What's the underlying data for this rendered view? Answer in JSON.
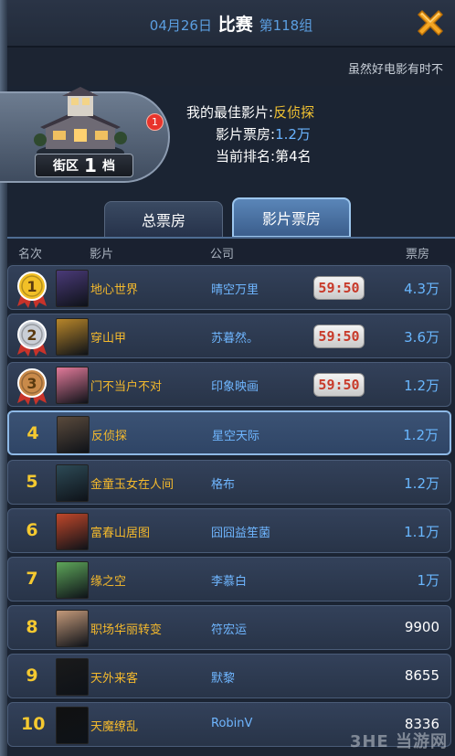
{
  "header": {
    "date": "04月26日",
    "title": "比赛",
    "group": "第118组"
  },
  "ticker": {
    "text": "虽然好电影有时不"
  },
  "district": {
    "label": "街区",
    "level": "1",
    "unit": "档",
    "badge_count": "1"
  },
  "summary": {
    "best_movie_label": "我的最佳影片:",
    "best_movie_value": "反侦探",
    "box_office_label": "影片票房:",
    "box_office_value": "1.2万",
    "rank_label": "当前排名:",
    "rank_value": "第4名"
  },
  "tabs": [
    {
      "label": "总票房",
      "active": false
    },
    {
      "label": "影片票房",
      "active": true
    }
  ],
  "columns": {
    "rank": "名次",
    "movie": "影片",
    "company": "公司",
    "box_office": "票房"
  },
  "rows": [
    {
      "rank": "1",
      "movie": "地心世界",
      "company": "晴空万里",
      "timer": "59:50",
      "box_office": "4.3万",
      "poster": "#4a3a78"
    },
    {
      "rank": "2",
      "movie": "穿山甲",
      "company": "苏暮然。",
      "timer": "59:50",
      "box_office": "3.6万",
      "poster": "#b8862a"
    },
    {
      "rank": "3",
      "movie": "门不当户不对",
      "company": "印象映画",
      "timer": "59:50",
      "box_office": "1.2万",
      "poster": "#e27a9a"
    },
    {
      "rank": "4",
      "movie": "反侦探",
      "company": "星空天际",
      "timer": "",
      "box_office": "1.2万",
      "poster": "#5a4a3c"
    },
    {
      "rank": "5",
      "movie": "金童玉女在人间",
      "company": "格布",
      "timer": "",
      "box_office": "1.2万",
      "poster": "#2d4a56"
    },
    {
      "rank": "6",
      "movie": "富春山居图",
      "company": "囧囧益笙菌",
      "timer": "",
      "box_office": "1.1万",
      "poster": "#c0472a"
    },
    {
      "rank": "7",
      "movie": "缘之空",
      "company": "李慕白",
      "timer": "",
      "box_office": "1万",
      "poster": "#5ea65a"
    },
    {
      "rank": "8",
      "movie": "职场华丽转变",
      "company": "符宏运",
      "timer": "",
      "box_office": "9900",
      "poster": "#c49a7a"
    },
    {
      "rank": "9",
      "movie": "天外来客",
      "company": "默黎",
      "timer": "",
      "box_office": "8655",
      "poster": "#1a1a1a"
    },
    {
      "rank": "10",
      "movie": "天魔缭乱",
      "company": "RobinV",
      "timer": "",
      "box_office": "8336",
      "poster": "#111111"
    }
  ],
  "medals": [
    {
      "rank": "1",
      "color": "#f2c027"
    },
    {
      "rank": "2",
      "color": "#c9ced6"
    },
    {
      "rank": "3",
      "color": "#c98a4a"
    }
  ],
  "watermark": "3HE 当游网",
  "colors": {
    "accent_blue": "#6ab3ff",
    "accent_gold": "#f2c232",
    "timer_red": "#c83a2a",
    "close_orange": "#f5a623"
  }
}
